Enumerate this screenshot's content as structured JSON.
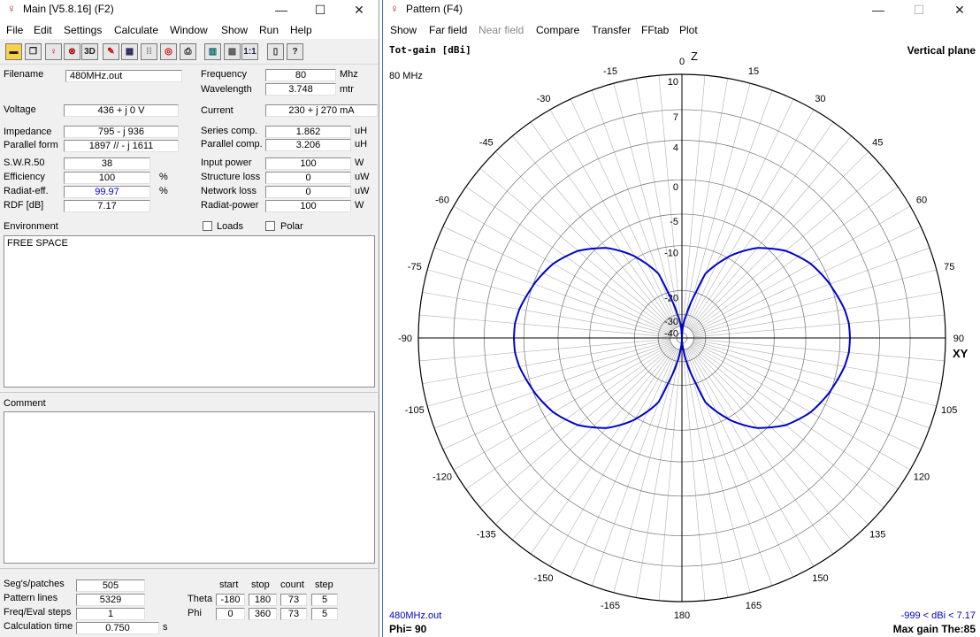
{
  "main_window": {
    "title": "Main [V5.8.16]  (F2)",
    "menu": [
      "File",
      "Edit",
      "Settings",
      "Calculate",
      "Window",
      "Show",
      "Run",
      "Help"
    ],
    "toolbar_icons": [
      "open-icon",
      "copy-icon",
      "bulb-icon",
      "geometry-icon",
      "3d-icon",
      "edit-icon",
      "calculator-icon",
      "dotted-grid-icon",
      "target-icon",
      "print-icon",
      "table-icon",
      "grid-icon",
      "ratio-icon",
      "book-icon",
      "help-icon"
    ],
    "toolbar_text": {
      "three_d": "3D",
      "ratio": "1:1",
      "help": "?"
    },
    "fields": {
      "filename": {
        "label": "Filename",
        "value": "480MHz.out"
      },
      "frequency": {
        "label": "Frequency",
        "value": "80",
        "unit": "Mhz"
      },
      "wavelength": {
        "label": "Wavelength",
        "value": "3.748",
        "unit": "mtr"
      },
      "voltage": {
        "label": "Voltage",
        "value": "436 + j 0 V"
      },
      "current": {
        "label": "Current",
        "value": "230 + j 270 mA"
      },
      "impedance": {
        "label": "Impedance",
        "value": "795 - j 936"
      },
      "series_comp": {
        "label": "Series comp.",
        "value": "1.862",
        "unit": "uH"
      },
      "parallel_form": {
        "label": "Parallel form",
        "value": "1897 // - j 1611"
      },
      "parallel_comp": {
        "label": "Parallel comp.",
        "value": "3.206",
        "unit": "uH"
      },
      "swr": {
        "label": "S.W.R.50",
        "value": "38"
      },
      "input_power": {
        "label": "Input power",
        "value": "100",
        "unit": "W"
      },
      "efficiency": {
        "label": "Efficiency",
        "value": "100",
        "unit": "%"
      },
      "structure_loss": {
        "label": "Structure loss",
        "value": "0",
        "unit": "uW"
      },
      "radiat_eff": {
        "label": "Radiat-eff.",
        "value": "99.97",
        "unit": "%"
      },
      "network_loss": {
        "label": "Network loss",
        "value": "0",
        "unit": "uW"
      },
      "rdf": {
        "label": "RDF [dB]",
        "value": "7.17"
      },
      "radiat_power": {
        "label": "Radiat-power",
        "value": "100",
        "unit": "W"
      }
    },
    "environment": {
      "label": "Environment",
      "text": "FREE SPACE",
      "loads_label": "Loads",
      "polar_label": "Polar",
      "loads_checked": false,
      "polar_checked": false
    },
    "comment": {
      "label": "Comment",
      "text": ""
    },
    "bottom": {
      "segs": {
        "label": "Seg's/patches",
        "value": "505"
      },
      "pattern_lines": {
        "label": "Pattern lines",
        "value": "5329"
      },
      "freq_eval_steps": {
        "label": "Freq/Eval steps",
        "value": "1"
      },
      "calc_time": {
        "label": "Calculation time",
        "value": "0.750",
        "unit": "s"
      },
      "headers": [
        "start",
        "stop",
        "count",
        "step"
      ],
      "theta": {
        "label": "Theta",
        "values": [
          "-180",
          "180",
          "73",
          "5"
        ]
      },
      "phi": {
        "label": "Phi",
        "values": [
          "0",
          "360",
          "73",
          "5"
        ]
      }
    }
  },
  "pattern_window": {
    "title": "Pattern    (F4)",
    "menu": [
      "Show",
      "Far field",
      "Near field",
      "Compare",
      "Transfer",
      "FFtab",
      "Plot"
    ],
    "menu_disabled": [
      "Near field"
    ],
    "tot_gain_label": "Tot-gain [dBi]",
    "plane_label": "Vertical plane",
    "freq_label": "80 MHz",
    "z_label": "Z",
    "xy_label": "XY",
    "file_label": "480MHz.out",
    "phi_label": "Phi= 90",
    "range_label": "-999 < dBi < 7.17",
    "max_gain_label": "Max gain The:85",
    "trace_color": "#0000cc"
  },
  "chart_data": {
    "type": "polar",
    "series": [
      {
        "theta_deg": [
          -180,
          -170,
          -160,
          -150,
          -140,
          -130,
          -120,
          -110,
          -100,
          -95,
          -90,
          -85,
          -80,
          -70,
          -60,
          -50,
          -40,
          -30,
          -20,
          -10,
          -5,
          0,
          5,
          10,
          20,
          30,
          40,
          50,
          60,
          70,
          80,
          85,
          90,
          95,
          100,
          110,
          120,
          130,
          140,
          150,
          160,
          170,
          180
        ],
        "gain_dbi": [
          -999,
          -31.4,
          -15.4,
          -9.7,
          -6.0,
          -3.3,
          -1.4,
          -0.1,
          0.7,
          0.95,
          1.0,
          0.95,
          0.7,
          -0.1,
          -1.4,
          -3.3,
          -6.0,
          -9.7,
          -15.4,
          -31.4,
          -40,
          -999,
          -40,
          -31.4,
          -15.4,
          -9.7,
          -6.0,
          -3.3,
          -1.4,
          -0.1,
          0.7,
          0.95,
          1.0,
          0.95,
          0.7,
          -0.1,
          -1.4,
          -3.3,
          -6.0,
          -9.7,
          -15.4,
          -31.4,
          -999
        ]
      }
    ],
    "radial_ticks_dbi": [
      10,
      7,
      4,
      0,
      -5,
      -10,
      -20,
      -30,
      -40
    ],
    "angle_labels": [
      0,
      15,
      30,
      45,
      60,
      75,
      90,
      105,
      120,
      135,
      150,
      165,
      180,
      -165,
      -150,
      -135,
      -120,
      -105,
      -90,
      -75,
      -60,
      -45,
      -30,
      -15
    ],
    "angle_step_minor": 5
  }
}
